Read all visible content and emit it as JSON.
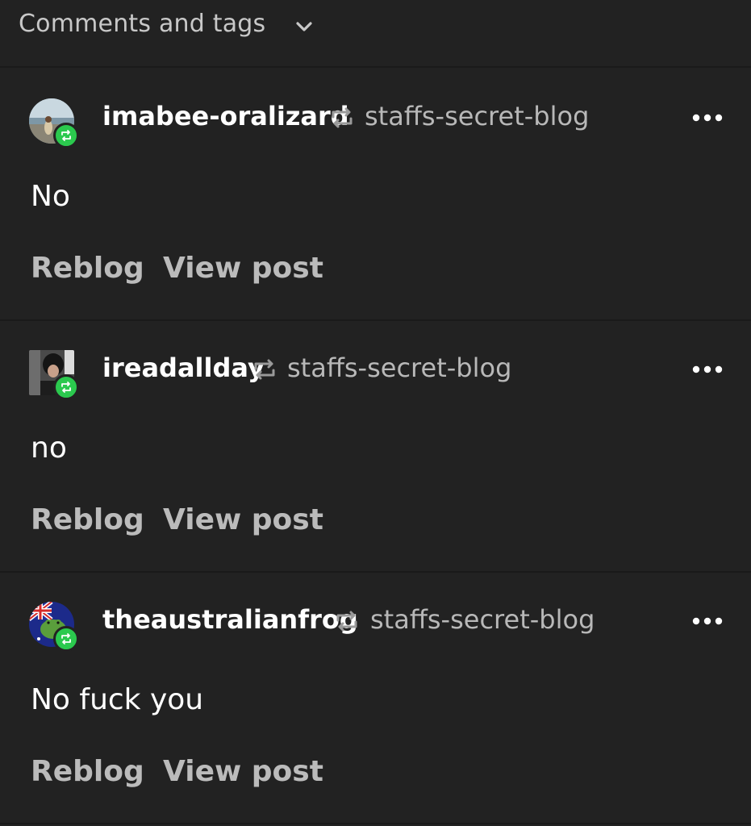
{
  "header": {
    "title": "Comments and tags",
    "chevron_icon": "chevron-down-icon"
  },
  "colors": {
    "background": "#222222",
    "username": "#ffffff",
    "secondary_text": "#b8b8b8",
    "reblog_badge": "#2bc94e"
  },
  "items": [
    {
      "username": "imabee-oralizard",
      "source_blog": "staffs-secret-blog",
      "comment": "No",
      "reblog_label": "Reblog",
      "view_post_label": "View post",
      "avatar_icon": "avatar-beach-photo"
    },
    {
      "username": "ireadallday",
      "source_blog": "staffs-secret-blog",
      "comment": "no",
      "reblog_label": "Reblog",
      "view_post_label": "View post",
      "avatar_icon": "avatar-person-photo"
    },
    {
      "username": "theaustralianfrog",
      "source_blog": "staffs-secret-blog",
      "comment": "No fuck you",
      "reblog_label": "Reblog",
      "view_post_label": "View post",
      "avatar_icon": "avatar-frog-flag"
    }
  ]
}
